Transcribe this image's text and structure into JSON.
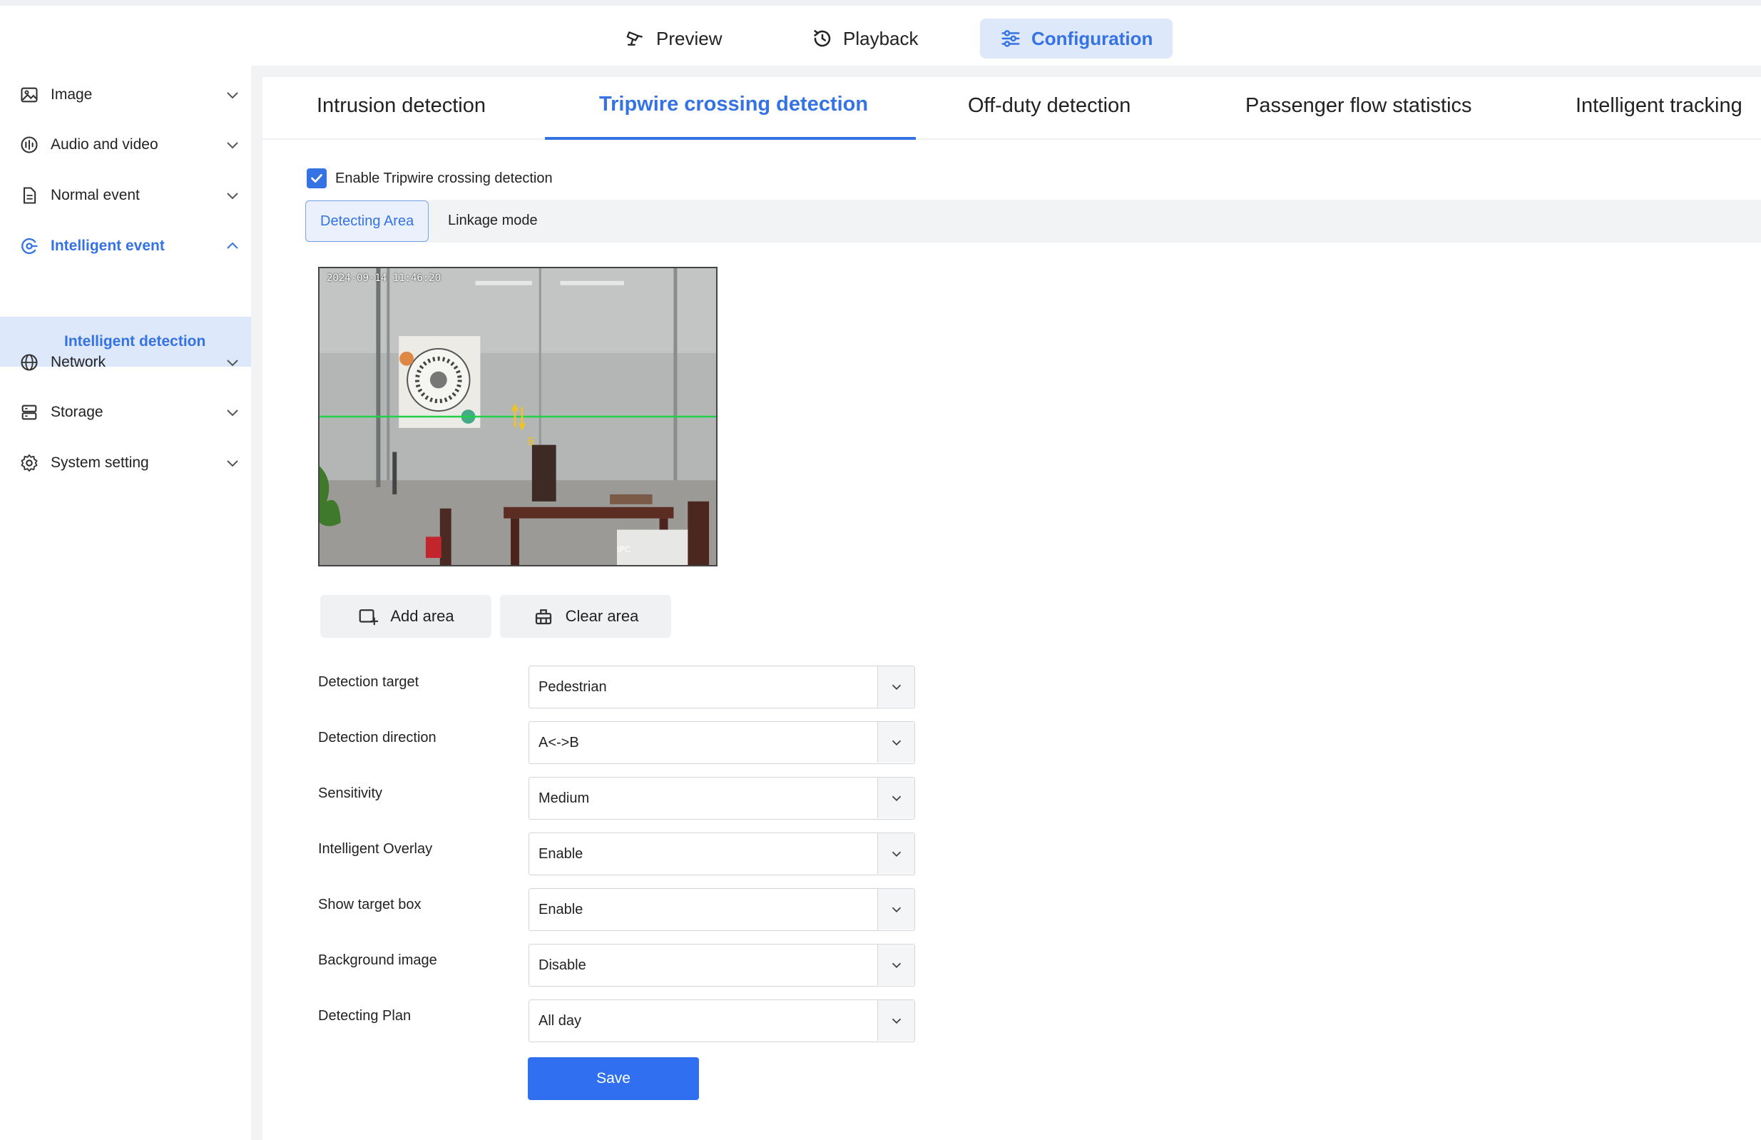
{
  "topnav": {
    "preview": "Preview",
    "playback": "Playback",
    "configuration": "Configuration"
  },
  "sidebar": {
    "items": [
      {
        "label": "Image",
        "icon": "image-icon"
      },
      {
        "label": "Audio and video",
        "icon": "audio-video-icon"
      },
      {
        "label": "Normal event",
        "icon": "document-icon"
      },
      {
        "label": "Intelligent event",
        "icon": "intelligent-event-icon"
      },
      {
        "label": "Network",
        "icon": "globe-icon"
      },
      {
        "label": "Storage",
        "icon": "storage-icon"
      },
      {
        "label": "System setting",
        "icon": "gear-icon"
      }
    ],
    "sub_item": "Intelligent detection"
  },
  "tabs": [
    "Intrusion detection",
    "Tripwire crossing detection",
    "Off-duty detection",
    "Passenger flow statistics",
    "Intelligent tracking"
  ],
  "enable_label": "Enable Tripwire crossing detection",
  "enable_checked": true,
  "subtabs": [
    "Detecting Area",
    "Linkage mode"
  ],
  "video": {
    "timestamp": "2024-09-14 11:46:20"
  },
  "buttons": {
    "add_area": "Add area",
    "clear_area": "Clear area",
    "save": "Save"
  },
  "fields": [
    {
      "label": "Detection target",
      "value": "Pedestrian"
    },
    {
      "label": "Detection direction",
      "value": "A<->B"
    },
    {
      "label": "Sensitivity",
      "value": "Medium"
    },
    {
      "label": "Intelligent Overlay",
      "value": "Enable"
    },
    {
      "label": "Show target box",
      "value": "Enable"
    },
    {
      "label": "Background image",
      "value": "Disable"
    },
    {
      "label": "Detecting Plan",
      "value": "All day"
    }
  ],
  "colors": {
    "accent": "#3572e3",
    "save_button": "#2f6ff0",
    "tripwire_line": "#22d14a"
  }
}
